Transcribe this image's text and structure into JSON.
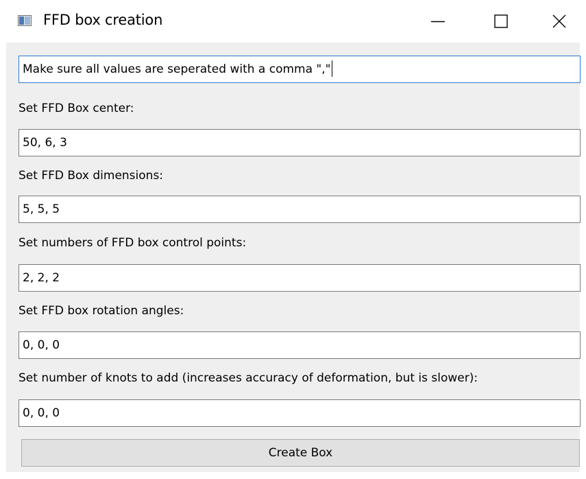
{
  "window": {
    "title": "FFD box creation",
    "icon": "app-window-icon",
    "controls": {
      "minimize_icon": "minimize-icon",
      "maximize_icon": "maximize-icon",
      "close_icon": "close-icon"
    }
  },
  "form": {
    "instruction": "Make sure all values are seperated with a comma \",\"",
    "fields": [
      {
        "label": "Set FFD Box center:",
        "value": "50, 6, 3"
      },
      {
        "label": "Set FFD Box dimensions:",
        "value": "5, 5, 5"
      },
      {
        "label": "Set numbers of FFD box control points:",
        "value": "2, 2, 2"
      },
      {
        "label": "Set FFD box rotation angles:",
        "value": "0, 0, 0"
      },
      {
        "label": "Set number of knots to add (increases accuracy of deformation, but is slower):",
        "value": "0, 0, 0"
      }
    ],
    "create_button_label": "Create Box"
  },
  "colors": {
    "focus_border": "#2b78d4",
    "client_background": "#efefef",
    "button_background": "#e1e1e1"
  }
}
